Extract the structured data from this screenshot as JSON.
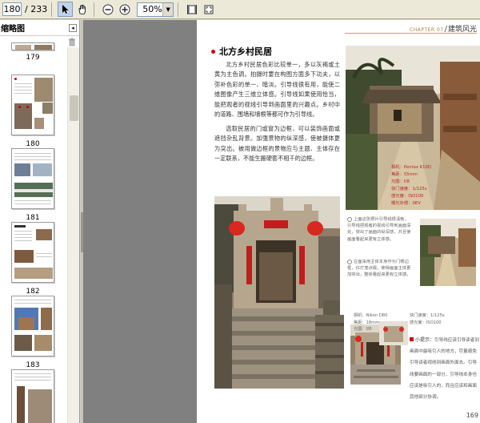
{
  "toolbar": {
    "page_current": "180",
    "page_total": "/ 233",
    "zoom": "50%"
  },
  "sidebar": {
    "title": "缩略图",
    "thumbnails": [
      {
        "label": "179"
      },
      {
        "label": "180"
      },
      {
        "label": "181"
      },
      {
        "label": "182"
      },
      {
        "label": "183"
      }
    ]
  },
  "page": {
    "chapter_en": "CHAPTER 07",
    "chapter_cn": "建筑风光",
    "section_title": "北方乡村民居",
    "paragraphs": [
      "北方乡村民居色彩比较单一，多以灰褐或土黄为主色调。拍摄时要在构图方面多下功夫，以弥补色彩的单一、暗淡。引导线很有用，能使二维图像产生三维立体感。引导线如果使用恰当，能把观者的视线引导到画面里的兴趣点。乡村中的道路、围墙和墙根等都可作为引导线。",
      "选取民居的门或窗为边框，可以装饰画面或遮挡杂乱背景。加强景物的纵深感，使被摄体更为突出。被用做边框的景物应与主题、主体存在一定联系，不能生搬硬套不相干的边框。"
    ],
    "exif_1": [
      "相机：Pentax K10D",
      "焦距：55mm",
      "光圈：f/8",
      "快门速度：1/125s",
      "感光度：ISO100",
      "曝光补偿：0EV"
    ],
    "caption_1": "上面这张照片引导线很清晰，引导线把观者的视线引导到画面深处，突出了画面的纵深感，并且使画面看起来更有立体感。",
    "caption_2": "左面采用主体本身作为门楼边框，红灯笼点缀，使得画面主体更加突出，整体看起来更有立体感。",
    "exif_2": [
      [
        "相机：Nikon D80",
        "快门速度：1/125s"
      ],
      [
        "焦距：18mm",
        "感光度：ISO100"
      ],
      [
        "光圈：f/8",
        ""
      ]
    ],
    "tip_title": "小提示：",
    "tip_body": "引导线应该引导读者到画面中最吸引人的地方，尽量避免引导读者视线到画面外面去。引导线要画面的一部分，引导线本身也应该是吸引人的，而且应该和画面其他部分协调。",
    "page_number": "169"
  }
}
